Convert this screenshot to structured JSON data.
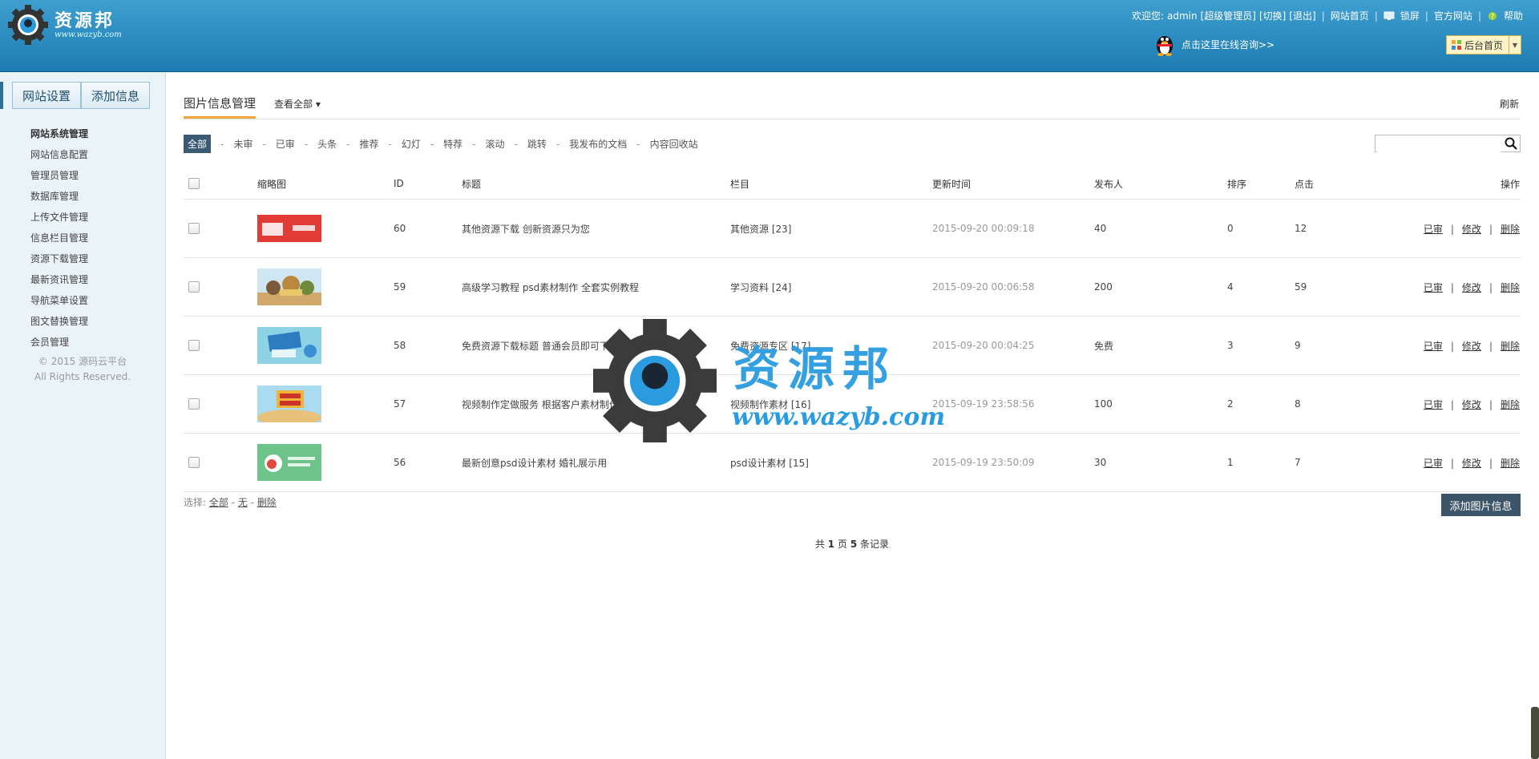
{
  "header": {
    "logo_text": "资源邦",
    "logo_url": "www.wazyb.com",
    "welcome": "欢迎您:",
    "user": "admin",
    "role": "[超级管理员]",
    "switch": "[切换]",
    "logout": "[退出]",
    "site_home": "网站首页",
    "lock": "锁屏",
    "official": "官方网站",
    "help": "帮助",
    "consult": "点击这里在线咨询>>",
    "home_btn": "后台首页"
  },
  "sidebar": {
    "tab1": "网站设置",
    "tab2": "添加信息",
    "menu": [
      "网站系统管理",
      "网站信息配置",
      "管理员管理",
      "数据库管理",
      "上传文件管理",
      "信息栏目管理",
      "资源下载管理",
      "最新资讯管理",
      "导航菜单设置",
      "图文替换管理",
      "会员管理"
    ],
    "footer1": "© 2015 源码云平台",
    "footer2": "All Rights Reserved."
  },
  "main": {
    "title": "图片信息管理",
    "view_all": "查看全部",
    "refresh": "刷新",
    "filters": [
      "全部",
      "未审",
      "已审",
      "头条",
      "推荐",
      "幻灯",
      "特荐",
      "滚动",
      "跳转",
      "我发布的文档",
      "内容回收站"
    ],
    "columns": [
      "缩略图",
      "ID",
      "标题",
      "栏目",
      "更新时间",
      "发布人",
      "排序",
      "点击",
      "操作"
    ],
    "rows": [
      {
        "id": "60",
        "title": "其他资源下载 创新资源只为您",
        "category": "其他资源 [23]",
        "time": "2015-09-20 00:09:18",
        "author": "40",
        "order": "0",
        "clicks": "12"
      },
      {
        "id": "59",
        "title": "高级学习教程 psd素材制作 全套实例教程",
        "category": "学习资料 [24]",
        "time": "2015-09-20 00:06:58",
        "author": "200",
        "order": "4",
        "clicks": "59"
      },
      {
        "id": "58",
        "title": "免费资源下载标题 普通会员即可下载",
        "category": "免费资源专区 [17]",
        "time": "2015-09-20 00:04:25",
        "author": "免费",
        "order": "3",
        "clicks": "9"
      },
      {
        "id": "57",
        "title": "视频制作定做服务 根据客户素材制作视频展示",
        "category": "视频制作素材 [16]",
        "time": "2015-09-19 23:58:56",
        "author": "100",
        "order": "2",
        "clicks": "8"
      },
      {
        "id": "56",
        "title": "最新创意psd设计素材 婚礼展示用",
        "category": "psd设计素材 [15]",
        "time": "2015-09-19 23:50:09",
        "author": "30",
        "order": "1",
        "clicks": "7"
      }
    ],
    "op_review": "已审",
    "op_edit": "修改",
    "op_delete": "删除",
    "select_label": "选择:",
    "select_all": "全部",
    "select_none": "无",
    "select_delete": "删除",
    "add_button": "添加图片信息",
    "pager_pre": "共",
    "pager_pages": "1",
    "pager_mid": "页",
    "pager_records": "5",
    "pager_post": "条记录"
  },
  "watermark": {
    "text": "资源邦",
    "url": "www.wazyb.com"
  },
  "colors": {
    "header": "#2a8cc2",
    "accent_tab": "#f0a63a",
    "dark_btn": "#3c5568",
    "watermark": "#2b9be0"
  }
}
